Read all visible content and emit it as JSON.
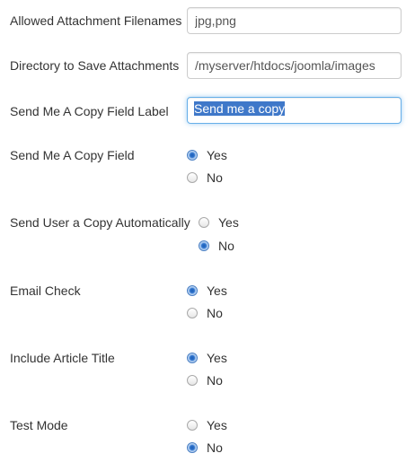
{
  "fields": {
    "allowed_filenames": {
      "label": "Allowed Attachment Filenames",
      "value": "jpg,png"
    },
    "save_directory": {
      "label": "Directory to Save Attachments",
      "value": "/myserver/htdocs/joomla/images"
    },
    "copy_field_label": {
      "label": "Send Me A Copy Field Label",
      "value": "Send me a copy"
    },
    "send_copy_field": {
      "label": "Send Me A Copy Field",
      "options": [
        "Yes",
        "No"
      ],
      "selected": "Yes"
    },
    "send_user_copy_auto": {
      "label": "Send User a Copy Automatically",
      "options": [
        "Yes",
        "No"
      ],
      "selected": "No"
    },
    "email_check": {
      "label": "Email Check",
      "options": [
        "Yes",
        "No"
      ],
      "selected": "Yes"
    },
    "include_article_title": {
      "label": "Include Article Title",
      "options": [
        "Yes",
        "No"
      ],
      "selected": "Yes"
    },
    "test_mode": {
      "label": "Test Mode",
      "options": [
        "Yes",
        "No"
      ],
      "selected": "No"
    }
  },
  "colors": {
    "accent": "#66afe9",
    "selection": "#3f78c9",
    "radio_selected": "#2f73cc"
  }
}
